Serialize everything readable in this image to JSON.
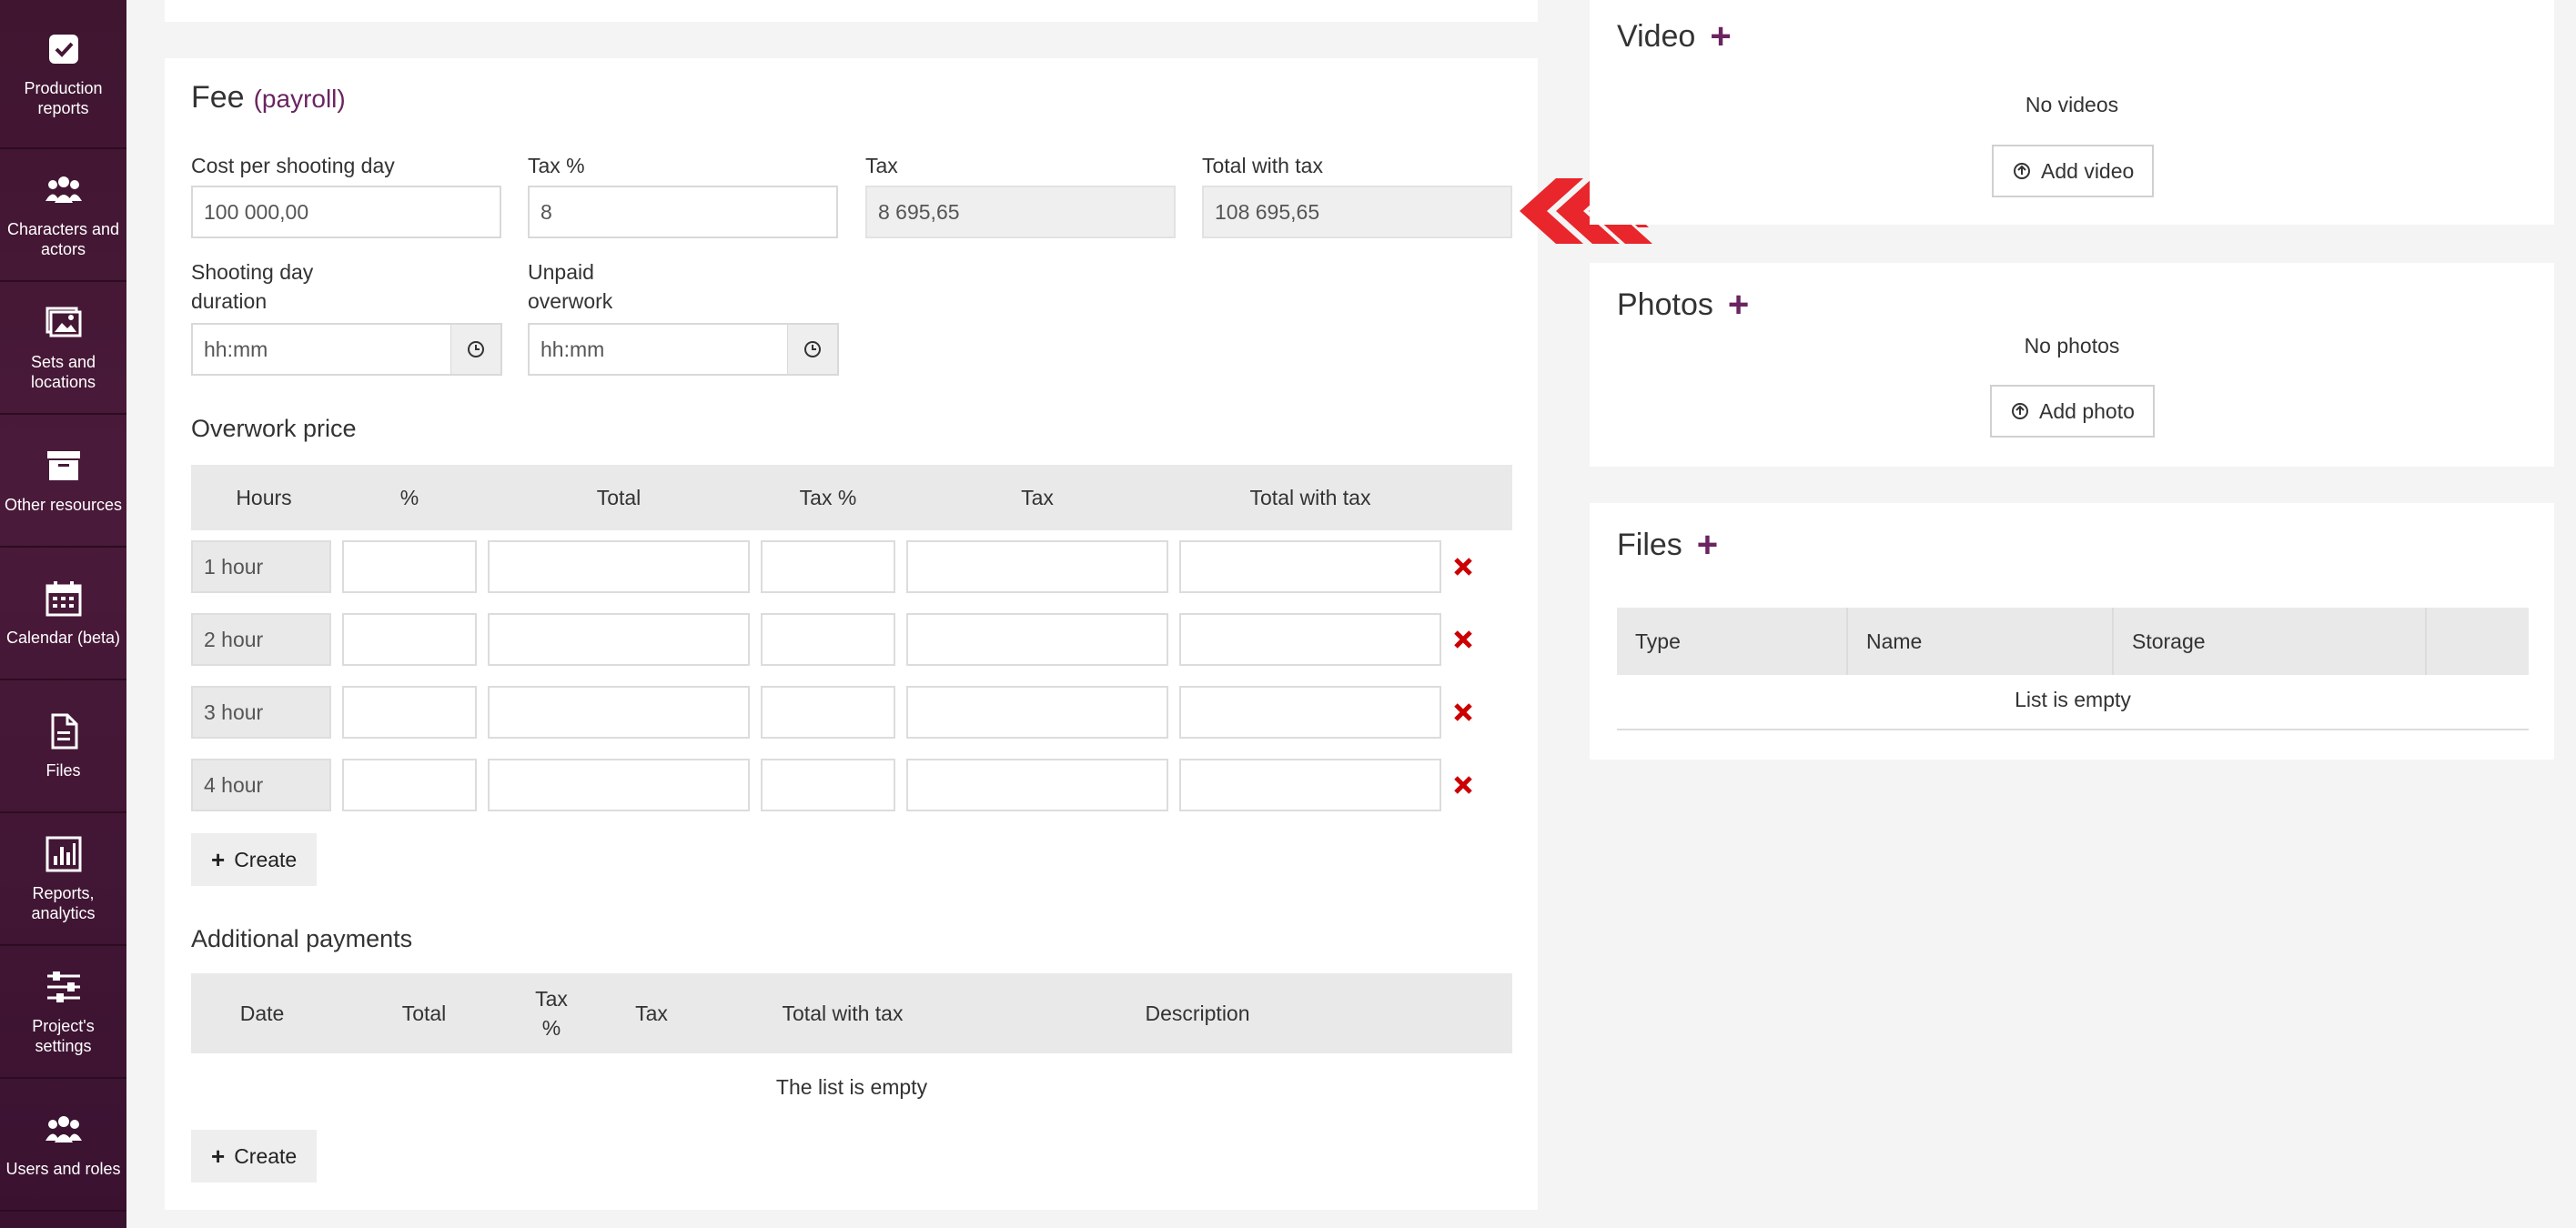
{
  "sidebar": {
    "items": [
      {
        "label": "Production reports",
        "icon": "checkbox-icon"
      },
      {
        "label": "Characters and actors",
        "icon": "users-icon"
      },
      {
        "label": "Sets and locations",
        "icon": "image-icon"
      },
      {
        "label": "Other resources",
        "icon": "archive-icon"
      },
      {
        "label": "Calendar (beta)",
        "icon": "calendar-icon"
      },
      {
        "label": "Files",
        "icon": "file-icon"
      },
      {
        "label": "Reports, analytics",
        "icon": "chart-icon"
      },
      {
        "label": "Project's settings",
        "icon": "sliders-icon"
      },
      {
        "label": "Users and roles",
        "icon": "users-icon"
      }
    ]
  },
  "fee": {
    "title": "Fee",
    "subtitle": "(payroll)",
    "cost_label": "Cost per shooting day",
    "cost_value": "100 000,00",
    "tax_pct_label": "Tax %",
    "tax_pct_value": "8",
    "tax_label": "Tax",
    "tax_value": "8 695,65",
    "total_label": "Total with tax",
    "total_value": "108 695,65",
    "duration_label_1": "Shooting day",
    "duration_label_2": "duration",
    "duration_placeholder": "hh:mm",
    "overwork_label_1": "Unpaid",
    "overwork_label_2": "overwork",
    "overwork_placeholder": "hh:mm"
  },
  "overwork": {
    "title": "Overwork price",
    "headers": [
      "Hours",
      "%",
      "Total",
      "Tax %",
      "Tax",
      "Total with tax"
    ],
    "rows": [
      "1 hour",
      "2 hour",
      "3 hour",
      "4 hour"
    ],
    "create_label": "Create"
  },
  "additional": {
    "title": "Additional payments",
    "headers": [
      "Date",
      "Total",
      "Tax",
      "%",
      "Tax",
      "Total with tax",
      "Description"
    ],
    "empty": "The list is empty",
    "create_label": "Create"
  },
  "video": {
    "title": "Video",
    "empty": "No videos",
    "button": "Add video"
  },
  "photos": {
    "title": "Photos",
    "empty": "No photos",
    "button": "Add photo"
  },
  "files": {
    "title": "Files",
    "headers": [
      "Type",
      "Name",
      "Storage"
    ],
    "empty": "List is empty"
  },
  "colors": {
    "sidebar": "#441835",
    "accent": "#6a2460",
    "arrow": "#e8262b",
    "delete": "#cc0000"
  }
}
